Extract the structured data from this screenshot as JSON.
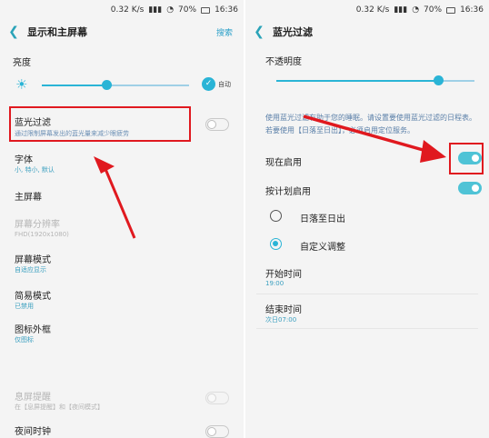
{
  "left": {
    "status": {
      "speed": "0.32 K/s",
      "battery": "70%",
      "time": "16:36"
    },
    "header": {
      "title": "显示和主屏幕",
      "action": "搜索"
    },
    "brightness": {
      "label": "亮度",
      "auto_label": "自动",
      "level": 0.44
    },
    "blue_filter": {
      "label": "蓝光过滤",
      "desc": "通过限制屏幕发出的蓝光量来减少眼疲劳"
    },
    "font": {
      "label": "字体",
      "desc": "小, 特小, 默认"
    },
    "home_screen": {
      "label": "主屏幕"
    },
    "resolution": {
      "label": "屏幕分辨率",
      "desc": "FHD(1920x1080)"
    },
    "screen_mode": {
      "label": "屏幕模式",
      "desc": "自适应显示"
    },
    "easy_mode": {
      "label": "简易模式",
      "desc": "已禁用"
    },
    "icon_frame": {
      "label": "图标外框",
      "desc": "仅图标"
    },
    "screen_saver": {
      "label": "息屏提醒",
      "desc": "在【息屏提醒】和【夜间模式】"
    },
    "night_clock": {
      "label": "夜间时钟"
    }
  },
  "right": {
    "status": {
      "speed": "0.32 K/s",
      "battery": "70%",
      "time": "16:36"
    },
    "header": {
      "title": "蓝光过滤"
    },
    "opacity": {
      "label": "不透明度",
      "level": 0.82
    },
    "desc": "使用蓝光过滤有助于您的睡眠。请设置要使用蓝光过滤的日程表。若要使用【日落至日出】，必须启用定位服务。",
    "turn_on_now": {
      "label": "现在启用",
      "on": true
    },
    "scheduled": {
      "label": "按计划启用",
      "on": true
    },
    "sunset": {
      "label": "日落至日出"
    },
    "custom": {
      "label": "自定义调整"
    },
    "start": {
      "label": "开始时间",
      "value": "19:00"
    },
    "end": {
      "label": "结束时间",
      "value": "次日07:00"
    }
  },
  "colors": {
    "accent": "#2ab4d6",
    "annotation_red": "#e0191f"
  }
}
